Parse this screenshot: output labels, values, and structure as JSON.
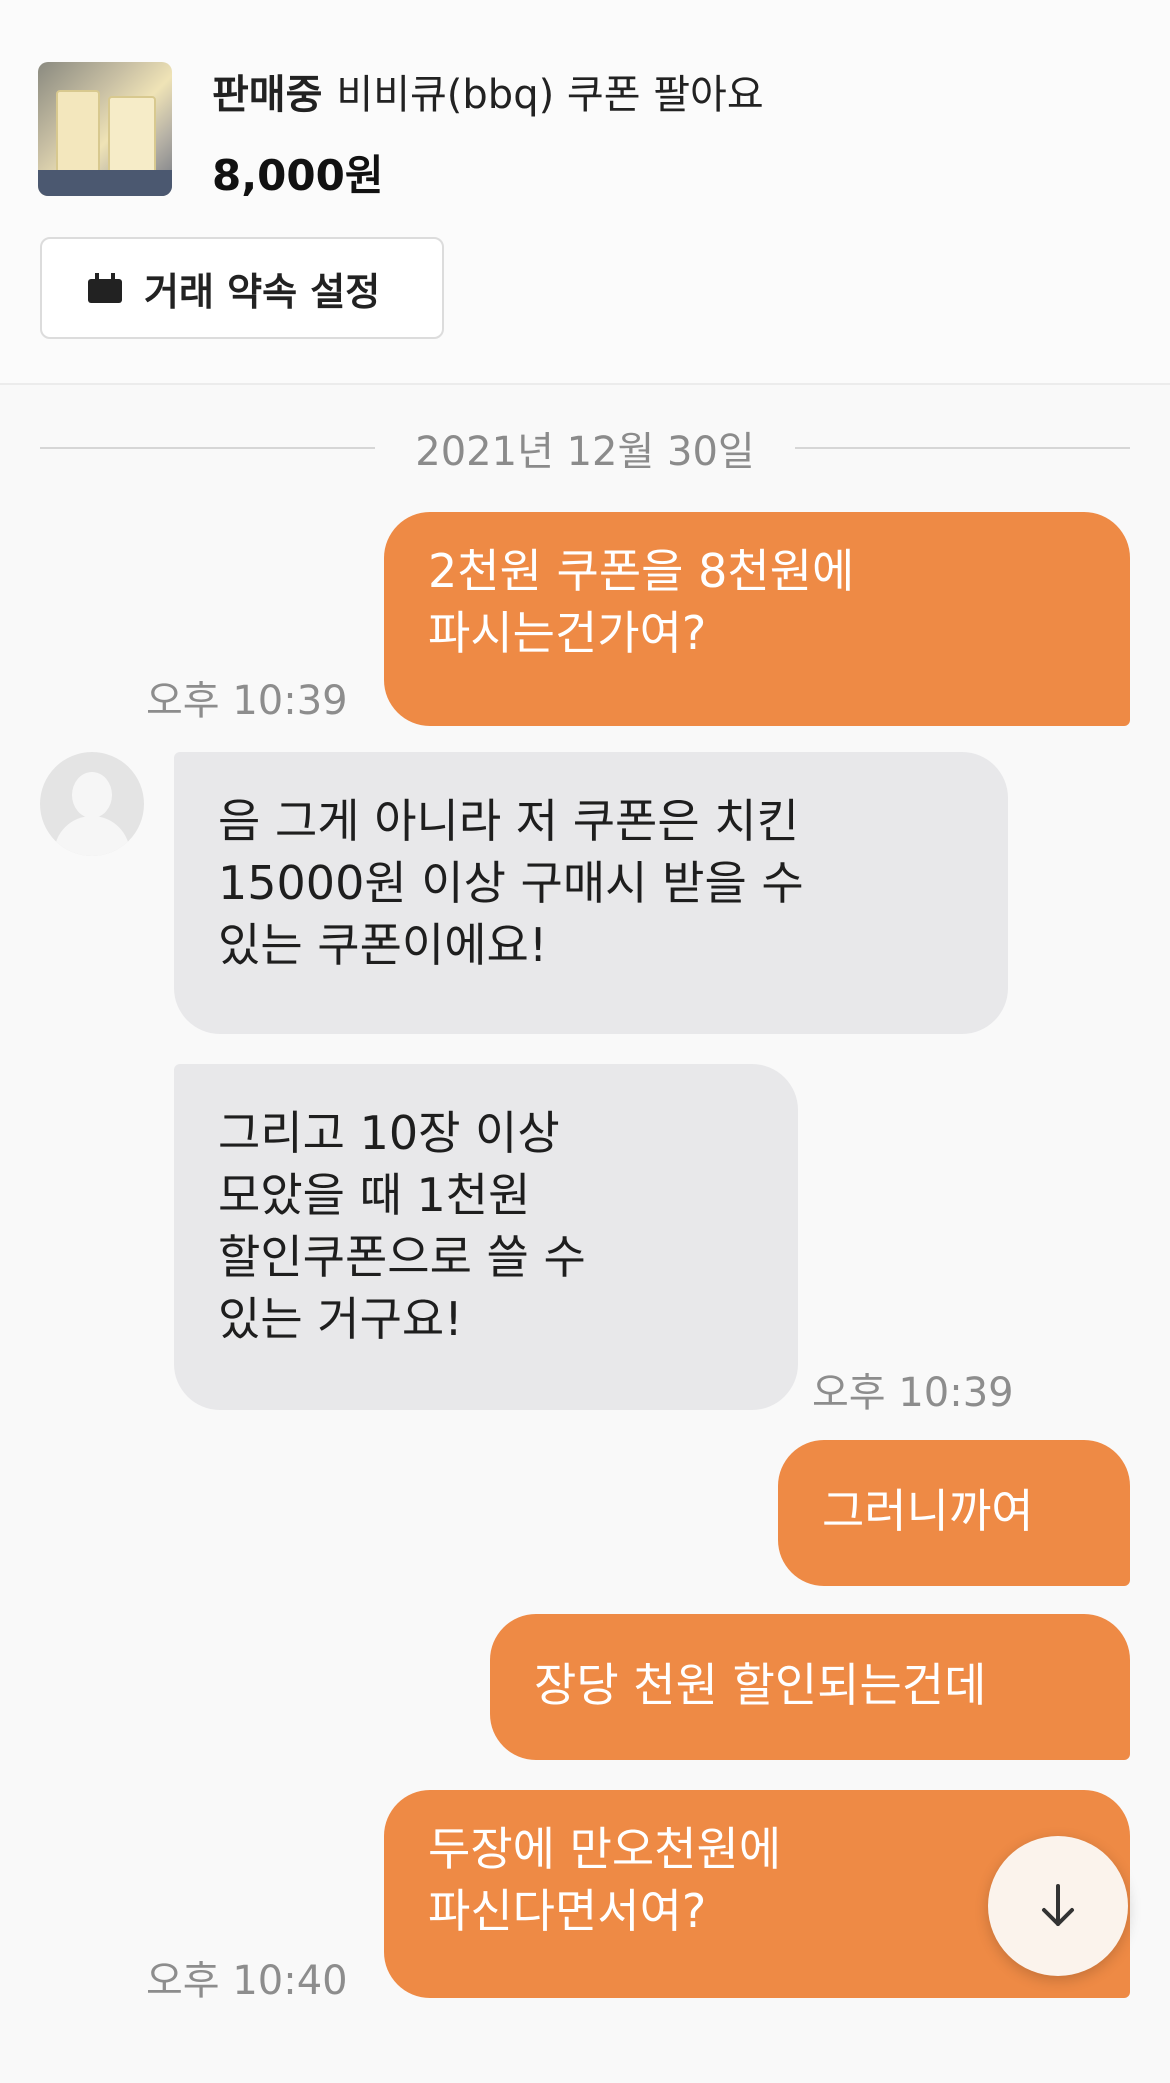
{
  "product": {
    "status": "판매중",
    "title": "비비큐(bbq) 쿠폰 팔아요",
    "price": "8,000원",
    "image_icon": "coupon-photo"
  },
  "appointment": {
    "icon": "calendar-icon",
    "label": "거래 약속 설정"
  },
  "date_divider": "2021년 12월 30일",
  "messages": [
    {
      "side": "sent",
      "lines": [
        "2천원 쿠폰을 8천원에",
        "파시는건가여?"
      ],
      "time": "오후 10:39"
    },
    {
      "side": "received",
      "lines": [
        "음 그게 아니라 저 쿠폰은 치킨",
        "15000원 이상 구매시 받을 수",
        "있는 쿠폰이에요!"
      ],
      "time": ""
    },
    {
      "side": "received",
      "lines": [
        "그리고 10장 이상",
        "모았을 때 1천원",
        "할인쿠폰으로 쓸 수",
        "있는 거구요!"
      ],
      "time": "오후 10:39"
    },
    {
      "side": "sent",
      "lines": [
        "그러니까여"
      ],
      "time": ""
    },
    {
      "side": "sent",
      "lines": [
        "장당 천원 할인되는건데"
      ],
      "time": ""
    },
    {
      "side": "sent",
      "lines": [
        "두장에 만오천원에",
        "파신다면서여?"
      ],
      "time": "오후 10:40"
    }
  ],
  "scroll_button": {
    "icon": "arrow-down-icon"
  },
  "colors": {
    "sent_bubble": "#ee8a45",
    "received_bubble": "#e8e8ea",
    "background": "#f9f9f9",
    "timestamp": "#8d8d8d"
  }
}
